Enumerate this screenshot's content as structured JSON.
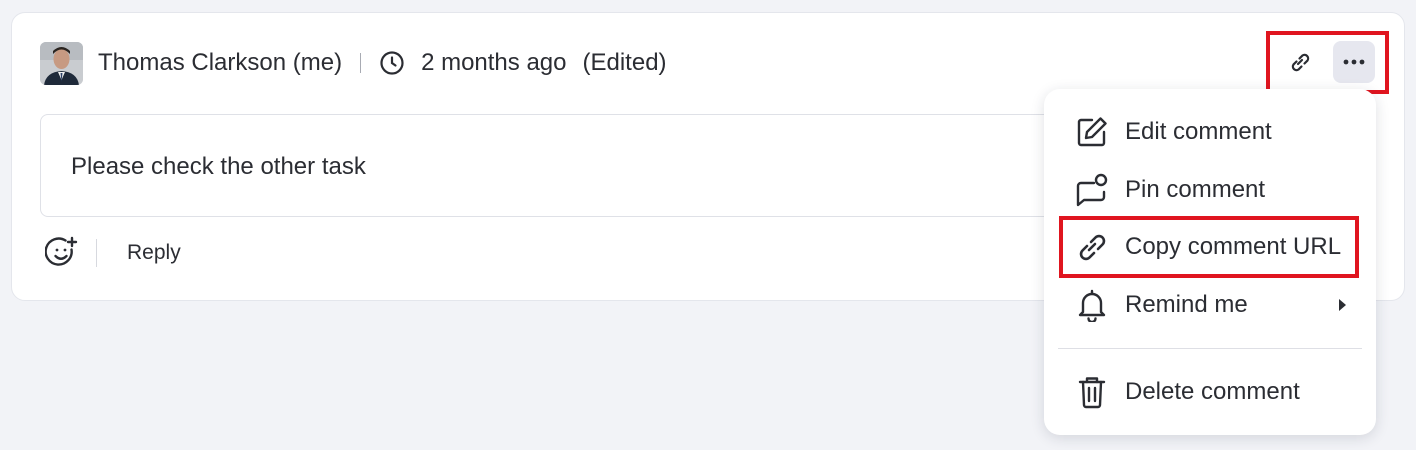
{
  "comment": {
    "author": "Thomas Clarkson (me)",
    "time": "2 months ago",
    "edited": "(Edited)",
    "text": "Please check the other task"
  },
  "actions": {
    "reply_label": "Reply",
    "emoji_icon": "add-reaction-icon"
  },
  "toolbar": {
    "link_icon": "link-icon",
    "more_icon": "more-horizontal-icon"
  },
  "menu": {
    "items": [
      {
        "label": "Edit comment",
        "icon": "edit-icon"
      },
      {
        "label": "Pin comment",
        "icon": "pin-comment-icon"
      },
      {
        "label": "Copy comment URL",
        "icon": "link-icon"
      },
      {
        "label": "Remind me",
        "icon": "bell-icon"
      },
      {
        "label": "Delete comment",
        "icon": "trash-icon"
      }
    ]
  },
  "colors": {
    "highlight": "#e0151f",
    "background": "#f2f3f7",
    "text": "#2b2d33"
  }
}
